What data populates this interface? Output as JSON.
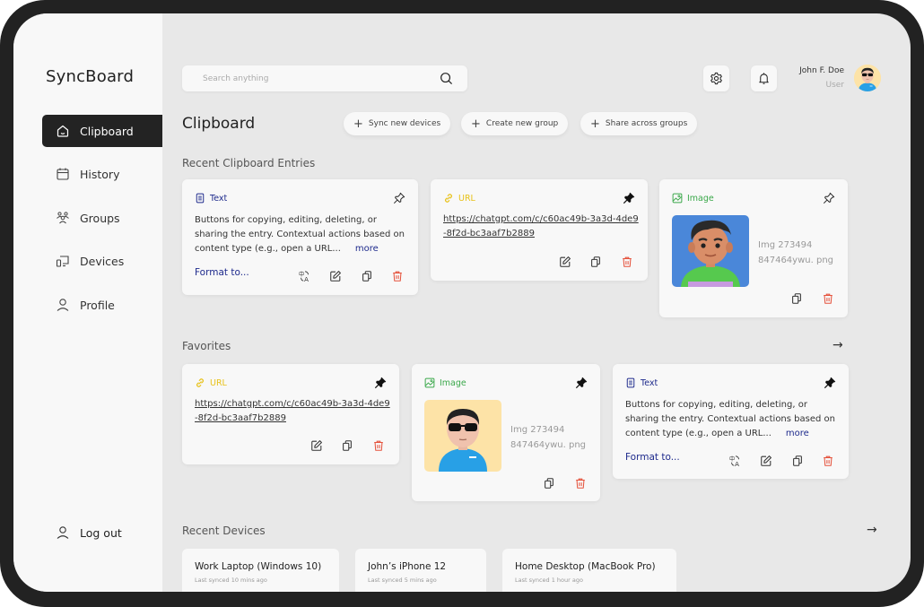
{
  "app": {
    "name": "SyncBoard"
  },
  "sidebar": {
    "items": [
      {
        "label": "Clipboard",
        "icon": "home-icon",
        "active": true
      },
      {
        "label": "History",
        "icon": "calendar-icon",
        "active": false
      },
      {
        "label": "Groups",
        "icon": "users-icon",
        "active": false
      },
      {
        "label": "Devices",
        "icon": "devices-icon",
        "active": false
      },
      {
        "label": "Profile",
        "icon": "user-icon",
        "active": false
      }
    ],
    "logout_label": "Log out"
  },
  "header": {
    "search_placeholder": "Search anything",
    "user": {
      "name": "John F. Doe",
      "role": "User"
    }
  },
  "page": {
    "title": "Clipboard",
    "actions": [
      {
        "label": "Sync new devices"
      },
      {
        "label": "Create new group"
      },
      {
        "label": "Share across groups"
      }
    ]
  },
  "colors": {
    "text_type": "#1e2a8c",
    "url_type": "#e8c21a",
    "image_type": "#3aa84a",
    "delete": "#e5533d",
    "active_nav": "#232323"
  },
  "recent": {
    "title": "Recent Clipboard Entries",
    "entries": [
      {
        "type": "Text",
        "pinned": false,
        "content": "Buttons for copying, editing, deleting, or sharing the entry. Contextual actions based on content type (e.g., open a URL...",
        "more_label": "more",
        "format_label": "Format to..."
      },
      {
        "type": "URL",
        "pinned": true,
        "content": "https://chatgpt.com/c/c60ac49b-3a3d-4de9-8f2d-bc3aaf7b2889"
      },
      {
        "type": "Image",
        "pinned": false,
        "file_line1": "Img 273494",
        "file_line2": "847464ywu. png"
      }
    ]
  },
  "favorites": {
    "title": "Favorites",
    "entries": [
      {
        "type": "URL",
        "pinned": true,
        "content": "https://chatgpt.com/c/c60ac49b-3a3d-4de9-8f2d-bc3aaf7b2889"
      },
      {
        "type": "Image",
        "pinned": true,
        "file_line1": "Img 273494",
        "file_line2": "847464ywu. png"
      },
      {
        "type": "Text",
        "pinned": true,
        "content": "Buttons for copying, editing, deleting, or sharing the entry. Contextual actions based on content type (e.g., open a URL...",
        "more_label": "more",
        "format_label": "Format to..."
      }
    ]
  },
  "devices": {
    "title": "Recent Devices",
    "items": [
      {
        "name": "Work Laptop (Windows 10)",
        "synced": "Last synced 10 mins ago"
      },
      {
        "name": "John’s iPhone 12",
        "synced": "Last synced 5 mins ago"
      },
      {
        "name": "Home Desktop (MacBook Pro)",
        "synced": "Last synced 1 hour ago"
      }
    ]
  }
}
